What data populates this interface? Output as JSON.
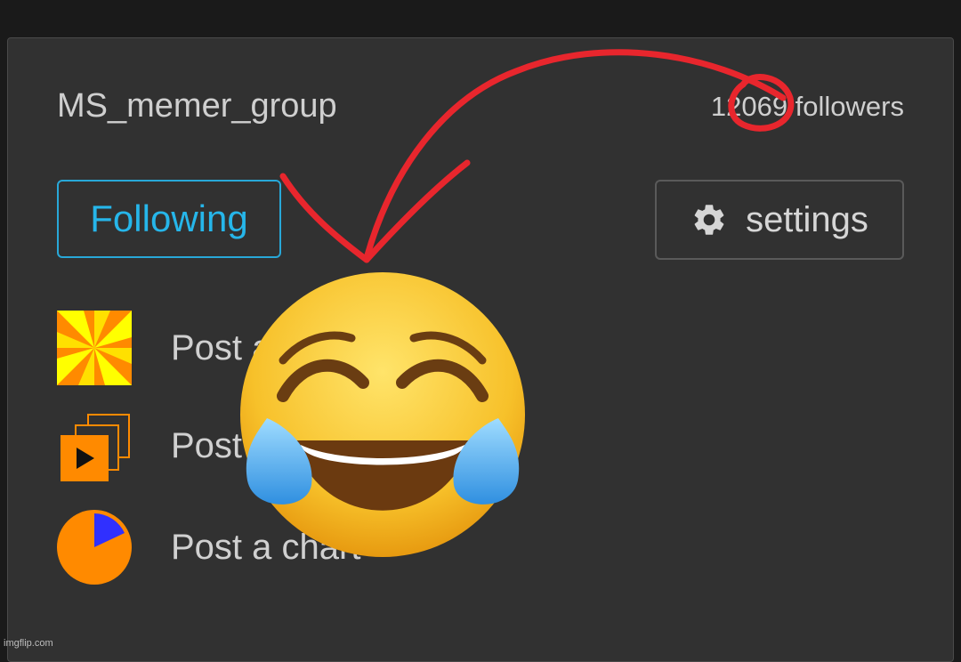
{
  "group": {
    "name": "MS_memer_group",
    "followers_text": "12069 followers"
  },
  "actions": {
    "following_label": "Following",
    "settings_label": "settings",
    "settings_icon": "gear-icon"
  },
  "menu": [
    {
      "label": "Post an image",
      "icon": "pinwheel-image-icon"
    },
    {
      "label": "Post a video",
      "icon": "stacked-video-icon"
    },
    {
      "label": "Post a chart",
      "icon": "pie-chart-icon"
    }
  ],
  "overlay": {
    "emoji": "face-with-tears-of-joy",
    "annotation_color": "#e8262d"
  },
  "watermark": "imgflip.com",
  "colors": {
    "accent": "#26b6ea",
    "panel": "#313131",
    "icon_orange": "#ff8a00",
    "icon_yellow": "#ffff00",
    "icon_blue": "#3030ff"
  }
}
